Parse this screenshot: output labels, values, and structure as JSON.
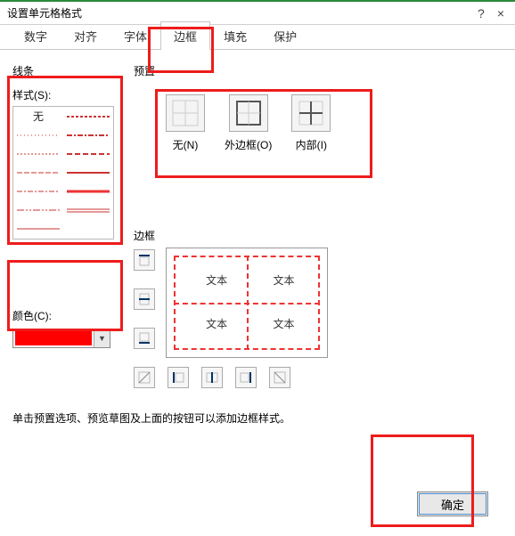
{
  "title": "设置单元格格式",
  "titlebar_help": "?",
  "titlebar_close": "×",
  "tabs": [
    "数字",
    "对齐",
    "字体",
    "边框",
    "填充",
    "保护"
  ],
  "active_tab_index": 3,
  "lines": {
    "group": "线条",
    "style_label": "样式(S):",
    "none": "无"
  },
  "color": {
    "label": "颜色(C):",
    "value_hex": "#ff0000"
  },
  "preset": {
    "group": "预置",
    "items": [
      {
        "label": "无(N)"
      },
      {
        "label": "外边框(O)"
      },
      {
        "label": "内部(I)"
      }
    ]
  },
  "border": {
    "group": "边框",
    "sample": "文本"
  },
  "hint": "单击预置选项、预览草图及上面的按钮可以添加边框样式。",
  "ok": "确定"
}
